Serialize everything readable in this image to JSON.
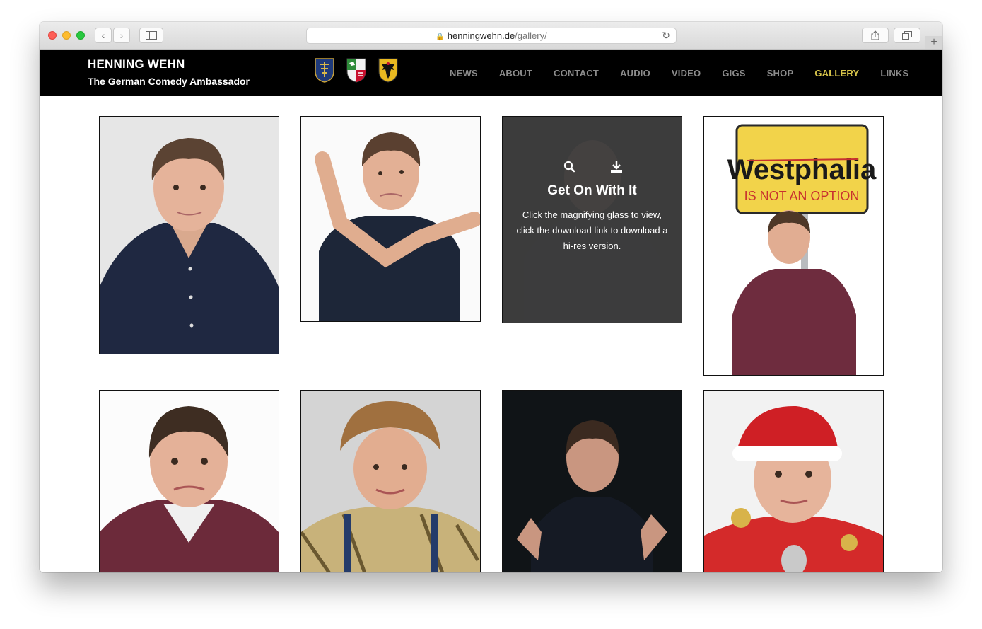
{
  "browser": {
    "url_domain": "henningwehn.de",
    "url_path": "/gallery/"
  },
  "site": {
    "title": "HENNING WEHN",
    "subtitle": "The German Comedy Ambassador",
    "flags": [
      "westphalia-coat-of-arms",
      "north-rhine-westphalia-coat-of-arms",
      "germany-coat-of-arms"
    ]
  },
  "nav": {
    "items": [
      "NEWS",
      "ABOUT",
      "CONTACT",
      "AUDIO",
      "VIDEO",
      "GIGS",
      "SHOP",
      "GALLERY",
      "LINKS"
    ],
    "active": "GALLERY",
    "active_color": "#d7c44a"
  },
  "gallery": {
    "hover_card": {
      "title": "Get On With It",
      "text": "Click the magnifying glass to view, click the download link to download a hi-res version.",
      "icons": [
        "magnifier-icon",
        "download-icon"
      ]
    },
    "sign": {
      "line1": "Westphalia",
      "line2": "IS NOT AN OPTION"
    }
  }
}
